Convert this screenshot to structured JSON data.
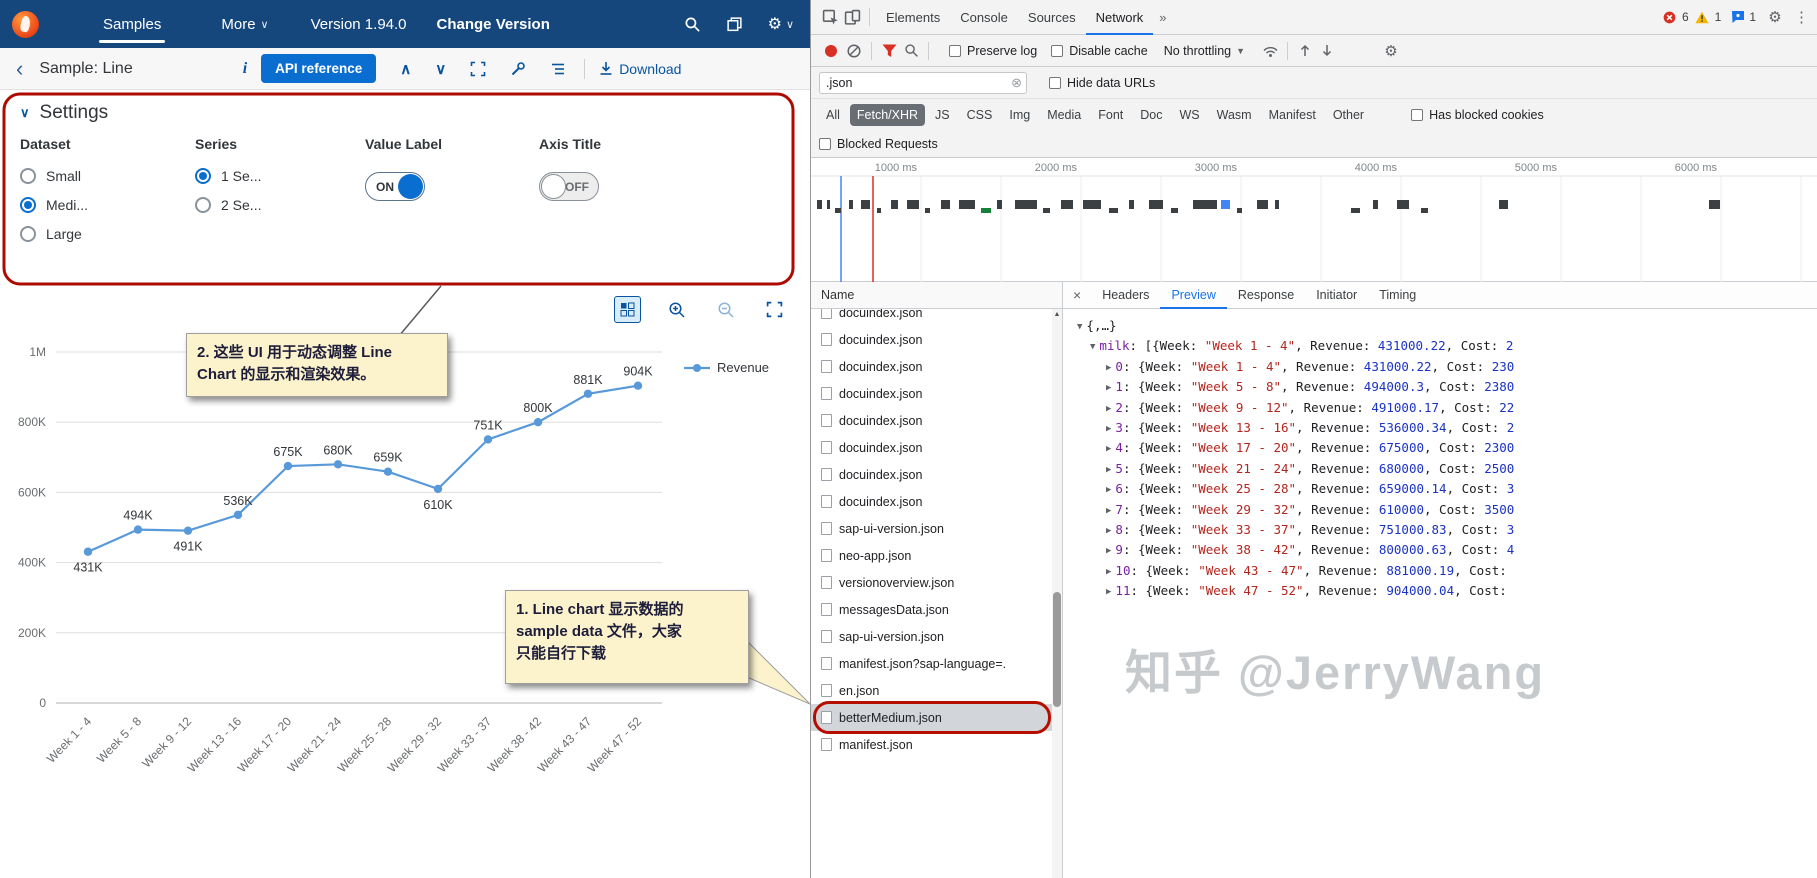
{
  "app": {
    "topbar": {
      "brand_tab": "Samples",
      "more": "More",
      "version": "Version 1.94.0",
      "change_version": "Change Version"
    },
    "toolbar": {
      "title": "Sample: Line",
      "info": "i",
      "api_reference": "API reference",
      "download": "Download"
    },
    "settings": {
      "title": "Settings",
      "dataset_label": "Dataset",
      "series_label": "Series",
      "value_label_label": "Value Label",
      "axis_title_label": "Axis Title",
      "dataset_options": [
        {
          "label": "Small",
          "selected": false
        },
        {
          "label": "Medi...",
          "selected": true
        },
        {
          "label": "Large",
          "selected": false
        }
      ],
      "series_options": [
        {
          "label": "1 Se...",
          "selected": true
        },
        {
          "label": "2 Se...",
          "selected": false
        }
      ],
      "value_label_state": "ON",
      "axis_title_state": "OFF"
    },
    "chart_data": {
      "type": "line",
      "categories": [
        "Week 1 - 4",
        "Week 5 - 8",
        "Week 9 - 12",
        "Week 13 - 16",
        "Week 17 - 20",
        "Week 21 - 24",
        "Week 25 - 28",
        "Week 29 - 32",
        "Week 33 - 37",
        "Week 38 - 42",
        "Week 43 - 47",
        "Week 47 - 52"
      ],
      "series": [
        {
          "name": "Revenue",
          "color": "#5899da",
          "values": [
            431000,
            494000,
            491000,
            536000,
            675000,
            680000,
            659000,
            610000,
            751000,
            800000,
            881000,
            904000
          ]
        }
      ],
      "point_labels": [
        "431K",
        "494K",
        "491K",
        "536K",
        "675K",
        "680K",
        "659K",
        "610K",
        "751K",
        "800K",
        "881K",
        "904K"
      ],
      "ylim": [
        0,
        1000000
      ],
      "ytick_labels": [
        "0",
        "200K",
        "400K",
        "600K",
        "800K",
        "1M"
      ],
      "grid": true,
      "legend_position": "right",
      "label_below_indices": [
        0,
        2,
        7
      ]
    },
    "annotations": {
      "note2_lines": [
        "2. 这些 UI 用于动态调整 Line",
        "Chart 的显示和渲染效果。"
      ],
      "note1_lines": [
        "1. Line chart 显示数据的",
        "sample data 文件，大家",
        "只能自行下载"
      ]
    }
  },
  "devtools": {
    "main_tabs": [
      "Elements",
      "Console",
      "Sources",
      "Network"
    ],
    "active_main_tab": "Network",
    "overflow_tabs": "»",
    "badges": {
      "error_count": "6",
      "warning_count": "1",
      "message_count": "1"
    },
    "network_toolbar": {
      "preserve_log": "Preserve log",
      "disable_cache": "Disable cache",
      "throttling": "No throttling"
    },
    "filter_row": {
      "filter_value": ".json",
      "hide_data_urls": "Hide data URLs"
    },
    "type_filters": [
      "All",
      "Fetch/XHR",
      "JS",
      "CSS",
      "Img",
      "Media",
      "Font",
      "Doc",
      "WS",
      "Wasm",
      "Manifest",
      "Other"
    ],
    "active_type_filter": "Fetch/XHR",
    "has_blocked_cookies": "Has blocked cookies",
    "blocked_requests": "Blocked Requests",
    "timeline": {
      "labels": [
        "1000 ms",
        "2000 ms",
        "3000 ms",
        "4000 ms",
        "5000 ms",
        "6000 ms"
      ],
      "markers": [
        {
          "x": 30,
          "color": "#4285f4"
        },
        {
          "x": 62,
          "color": "#d93025"
        }
      ],
      "bars": [
        {
          "x": 6,
          "w": 5
        },
        {
          "x": 16,
          "w": 3
        },
        {
          "x": 24,
          "w": 6
        },
        {
          "x": 38,
          "w": 4
        },
        {
          "x": 50,
          "w": 9
        },
        {
          "x": 66,
          "w": 4
        },
        {
          "x": 80,
          "w": 7
        },
        {
          "x": 96,
          "w": 12
        },
        {
          "x": 114,
          "w": 5
        },
        {
          "x": 130,
          "w": 9
        },
        {
          "x": 148,
          "w": 16
        },
        {
          "x": 170,
          "w": 10,
          "c": "#188038"
        },
        {
          "x": 186,
          "w": 5
        },
        {
          "x": 204,
          "w": 22
        },
        {
          "x": 232,
          "w": 7
        },
        {
          "x": 250,
          "w": 12
        },
        {
          "x": 272,
          "w": 18
        },
        {
          "x": 298,
          "w": 9
        },
        {
          "x": 318,
          "w": 5
        },
        {
          "x": 338,
          "w": 14
        },
        {
          "x": 360,
          "w": 7
        },
        {
          "x": 382,
          "w": 24
        },
        {
          "x": 410,
          "w": 9,
          "c": "#4285f4"
        },
        {
          "x": 426,
          "w": 5
        },
        {
          "x": 446,
          "w": 11
        },
        {
          "x": 464,
          "w": 4
        },
        {
          "x": 540,
          "w": 9
        },
        {
          "x": 562,
          "w": 5
        },
        {
          "x": 586,
          "w": 12
        },
        {
          "x": 610,
          "w": 7
        },
        {
          "x": 688,
          "w": 9
        },
        {
          "x": 898,
          "w": 11
        }
      ]
    },
    "requests_header": "Name",
    "requests": [
      {
        "name": "docuindex.json",
        "partial": true
      },
      {
        "name": "docuindex.json"
      },
      {
        "name": "docuindex.json"
      },
      {
        "name": "docuindex.json"
      },
      {
        "name": "docuindex.json"
      },
      {
        "name": "docuindex.json"
      },
      {
        "name": "docuindex.json"
      },
      {
        "name": "docuindex.json"
      },
      {
        "name": "sap-ui-version.json"
      },
      {
        "name": "neo-app.json"
      },
      {
        "name": "versionoverview.json"
      },
      {
        "name": "messagesData.json"
      },
      {
        "name": "sap-ui-version.json"
      },
      {
        "name": "manifest.json?sap-language=."
      },
      {
        "name": "en.json"
      },
      {
        "name": "betterMedium.json",
        "selected": true,
        "highlighted": true
      },
      {
        "name": "manifest.json"
      }
    ],
    "detail_tabs": [
      "Headers",
      "Preview",
      "Response",
      "Initiator",
      "Timing"
    ],
    "active_detail_tab": "Preview",
    "preview_lines": [
      {
        "expander": "▼",
        "key": "",
        "rest": "{,…}",
        "indent": 0
      },
      {
        "expander": "▼",
        "key": "milk",
        "rest": ": [{Week: \"Week 1 - 4\", Revenue: 431000.22, Cost: 2",
        "indent": 1
      },
      {
        "expander": "▶",
        "key": "0",
        "rest": ": {Week: \"Week 1 - 4\", Revenue: 431000.22, Cost: 230",
        "indent": 2
      },
      {
        "expander": "▶",
        "key": "1",
        "rest": ": {Week: \"Week 5 - 8\", Revenue: 494000.3, Cost: 2380",
        "indent": 2
      },
      {
        "expander": "▶",
        "key": "2",
        "rest": ": {Week: \"Week 9 - 12\", Revenue: 491000.17, Cost: 22",
        "indent": 2
      },
      {
        "expander": "▶",
        "key": "3",
        "rest": ": {Week: \"Week 13 - 16\", Revenue: 536000.34, Cost: 2",
        "indent": 2
      },
      {
        "expander": "▶",
        "key": "4",
        "rest": ": {Week: \"Week 17 - 20\", Revenue: 675000, Cost: 2300",
        "indent": 2
      },
      {
        "expander": "▶",
        "key": "5",
        "rest": ": {Week: \"Week 21 - 24\", Revenue: 680000, Cost: 2500",
        "indent": 2
      },
      {
        "expander": "▶",
        "key": "6",
        "rest": ": {Week: \"Week 25 - 28\", Revenue: 659000.14, Cost: 3",
        "indent": 2
      },
      {
        "expander": "▶",
        "key": "7",
        "rest": ": {Week: \"Week 29 - 32\", Revenue: 610000, Cost: 3500",
        "indent": 2
      },
      {
        "expander": "▶",
        "key": "8",
        "rest": ": {Week: \"Week 33 - 37\", Revenue: 751000.83, Cost: 3",
        "indent": 2
      },
      {
        "expander": "▶",
        "key": "9",
        "rest": ": {Week: \"Week 38 - 42\", Revenue: 800000.63, Cost: 4",
        "indent": 2
      },
      {
        "expander": "▶",
        "key": "10",
        "rest": ": {Week: \"Week 43 - 47\", Revenue: 881000.19, Cost:",
        "indent": 2
      },
      {
        "expander": "▶",
        "key": "11",
        "rest": ": {Week: \"Week 47 - 52\", Revenue: 904000.04, Cost:",
        "indent": 2
      }
    ]
  },
  "watermark": "知乎 @JerryWang"
}
